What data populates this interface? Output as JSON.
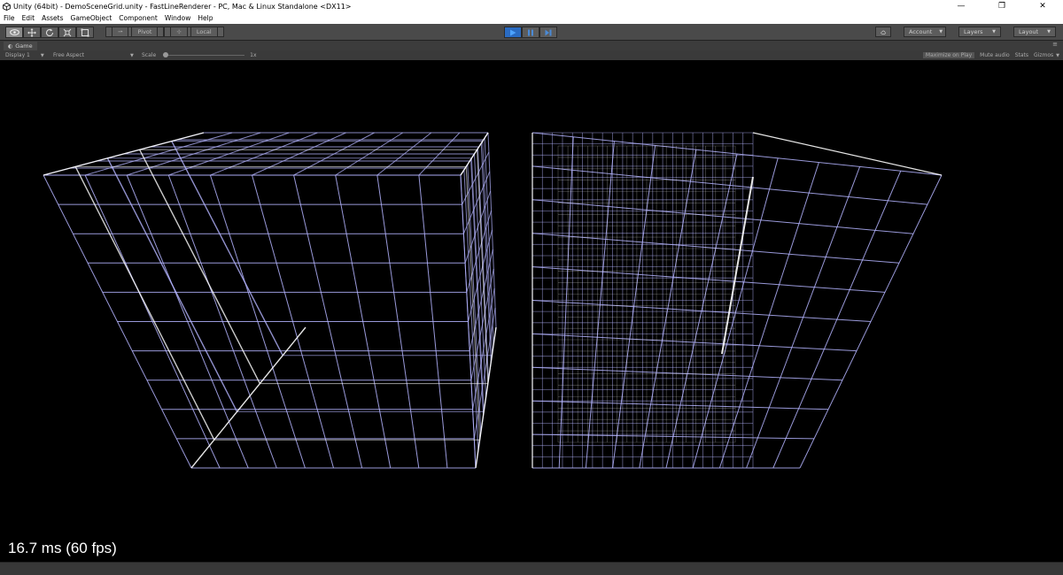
{
  "window": {
    "title": "Unity (64bit) - DemoSceneGrid.unity - FastLineRenderer - PC, Mac & Linux Standalone <DX11>",
    "minimize": "—",
    "restore": "❐",
    "close": "✕"
  },
  "menu": [
    "File",
    "Edit",
    "Assets",
    "GameObject",
    "Component",
    "Window",
    "Help"
  ],
  "toolbar": {
    "pivot_label": "Pivot",
    "local_label": "Local",
    "account_label": "Account",
    "layers_label": "Layers",
    "layout_label": "Layout"
  },
  "game_tab": {
    "label": "Game",
    "menu": "≡"
  },
  "game_options": {
    "display": "Display 1",
    "aspect": "Free Aspect",
    "scale_label": "Scale",
    "scale_value": "1x",
    "maximize_on_play": "Maximize on Play",
    "mute_audio": "Mute audio",
    "stats": "Stats",
    "gizmos": "Gizmos"
  },
  "fps_readout": "16.7 ms (60 fps)",
  "colors": {
    "line": "#b4b4ff",
    "line_bright": "#ffffff",
    "play_active": "#2a6bc2"
  }
}
